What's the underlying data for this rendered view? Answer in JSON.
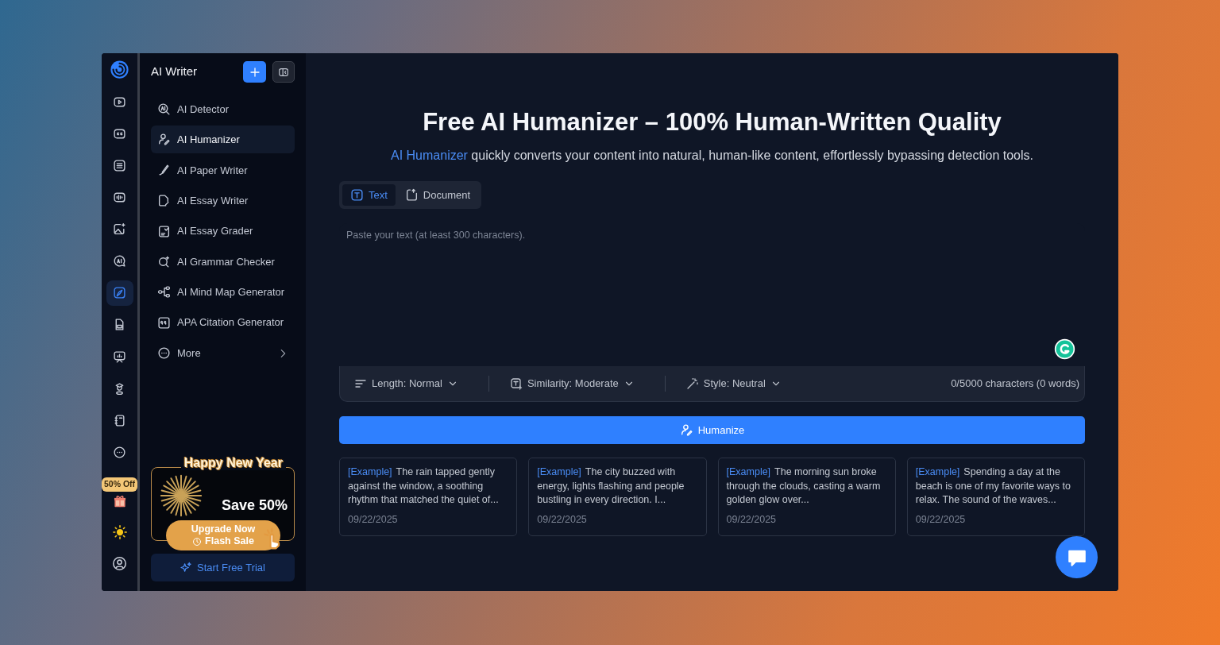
{
  "rail": {
    "items": [
      {
        "selected": false
      },
      {
        "selected": false
      },
      {
        "selected": false
      },
      {
        "selected": false
      },
      {
        "selected": false
      },
      {
        "selected": false
      },
      {
        "selected": true
      },
      {
        "selected": false
      },
      {
        "selected": false
      },
      {
        "selected": false
      },
      {
        "selected": false
      },
      {
        "selected": false
      }
    ],
    "offer_badge": "50% Off"
  },
  "sidebar": {
    "title": "AI Writer",
    "items": [
      {
        "label": "AI Detector",
        "selected": false
      },
      {
        "label": "AI Humanizer",
        "selected": true
      },
      {
        "label": "AI Paper Writer",
        "selected": false
      },
      {
        "label": "AI Essay Writer",
        "selected": false
      },
      {
        "label": "AI Essay Grader",
        "selected": false
      },
      {
        "label": "AI Grammar Checker",
        "selected": false
      },
      {
        "label": "AI Mind Map Generator",
        "selected": false
      },
      {
        "label": "APA Citation Generator",
        "selected": false
      },
      {
        "label": "More",
        "selected": false
      }
    ],
    "promo": {
      "headline": "Happy New Year",
      "offer": "Save 50%",
      "button": "Upgrade Now",
      "sale": "Flash Sale"
    },
    "trial_button": "Start Free Trial"
  },
  "main": {
    "title": "Free AI Humanizer – 100% Human-Written Quality",
    "subtitle_link": "AI Humanizer",
    "subtitle": " quickly converts your content into natural, human-like content, effortlessly bypassing detection tools.",
    "tabs": [
      {
        "label": "Text",
        "selected": true
      },
      {
        "label": "Document",
        "selected": false
      }
    ],
    "input": {
      "placeholder": "Paste your text (at least 300 characters)."
    },
    "options": [
      {
        "label": "Length: Normal"
      },
      {
        "label": "Similarity: Moderate"
      },
      {
        "label": "Style: Neutral"
      }
    ],
    "counter": "0/5000 characters (0 words)",
    "action_button": "Humanize",
    "examples": [
      {
        "tag": "[Example]",
        "text": "The rain tapped gently against the window, a soothing rhythm that matched the quiet of...",
        "date": "09/22/2025"
      },
      {
        "tag": "[Example]",
        "text": "The city buzzed with energy, lights flashing and people bustling in every direction. I...",
        "date": "09/22/2025"
      },
      {
        "tag": "[Example]",
        "text": "The morning sun broke through the clouds, casting a warm golden glow over...",
        "date": "09/22/2025"
      },
      {
        "tag": "[Example]",
        "text": "Spending a day at the beach is one of my favorite ways to relax. The sound of the waves...",
        "date": "09/22/2025"
      }
    ]
  }
}
